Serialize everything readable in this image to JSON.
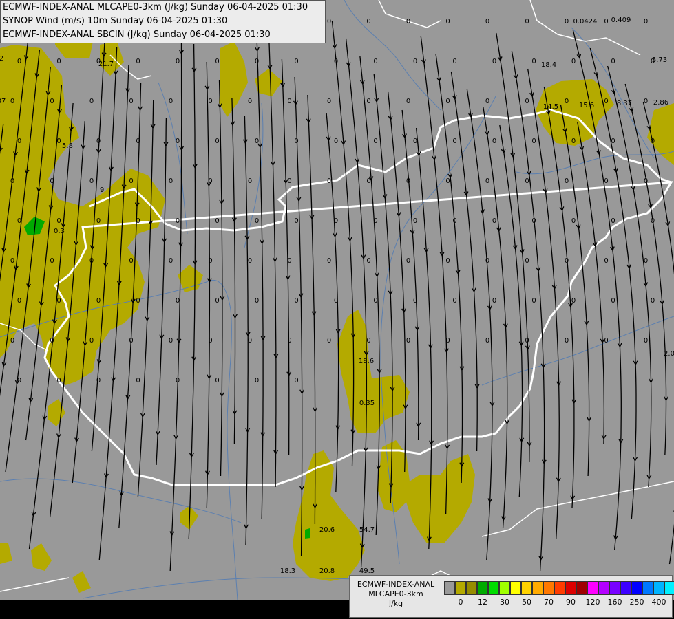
{
  "titles": [
    "ECMWF-INDEX-ANAL MLCAPE0-3km (J/kg) Sunday 06-04-2025 01:30",
    "SYNOP Wind (m/s) 10m Sunday 06-04-2025 01:30",
    "ECMWF-INDEX-ANAL SBCIN (J/kg) Sunday 06-04-2025 01:30"
  ],
  "legend": {
    "line1": "ECMWF-INDEX-ANAL",
    "line2": "MLCAPE0-3km",
    "unit": "J/kg",
    "colors": [
      "#999999",
      "#b4aa00",
      "#968c00",
      "#00aa00",
      "#00dc00",
      "#a0ff00",
      "#ffff00",
      "#ffd200",
      "#ffaa00",
      "#ff7800",
      "#ff3c00",
      "#dc0000",
      "#a00000",
      "#ff00ff",
      "#b400ff",
      "#7800ff",
      "#3c00ff",
      "#0000ff",
      "#0078ff",
      "#00b4ff",
      "#00f0ff",
      "#a0ffff",
      "#ffffff"
    ],
    "ticks": [
      "0",
      "12",
      "30",
      "50",
      "70",
      "90",
      "120",
      "160",
      "250",
      "400"
    ]
  },
  "colors": {
    "background": "#999999",
    "cape": "#b4aa00",
    "cape_high": "#00aa00",
    "border": "#ffffff",
    "river": "#5b7fb0",
    "streamline": "#000000"
  },
  "cin_labels": [
    "0",
    "0",
    "0",
    "0",
    "0",
    "0",
    "0",
    "0",
    "0",
    "0",
    "0",
    "0",
    "0",
    "0",
    "0",
    "0",
    "0",
    "0",
    "0",
    "0",
    "0",
    "0",
    "0",
    "0",
    "0",
    "0",
    "0",
    "0",
    "0",
    "0",
    "0",
    "0",
    "0",
    "0",
    "0",
    "0",
    "0",
    "0",
    "0",
    "0",
    "0",
    "0",
    "0",
    "0",
    "0",
    "0",
    "0",
    "0",
    "0",
    "0",
    "0",
    "0",
    "0",
    "0",
    "0",
    "0",
    "0",
    "0",
    "0",
    "0",
    "0",
    "0",
    "0",
    "0",
    "0",
    "0",
    "0",
    "0",
    "0",
    "0",
    "0",
    "0",
    "0",
    "0",
    "0",
    "0",
    "0",
    "0",
    "0",
    "0",
    "0",
    "0",
    "0",
    "0",
    "0",
    "0",
    "0",
    "0",
    "0",
    "0",
    "0",
    "0",
    "0",
    "0",
    "0",
    "0",
    "0",
    "0",
    "0",
    "0",
    "0",
    "0",
    "0",
    "0",
    "0",
    "0",
    "0",
    "0",
    "0",
    "0",
    "0",
    "0",
    "0",
    "0",
    "0",
    "0",
    "0",
    "0",
    "0",
    "0",
    "0",
    "0",
    "0",
    "0",
    "0",
    "0",
    "0",
    "0",
    "0",
    "0",
    "0",
    "0",
    "0",
    "0",
    "0",
    "0",
    "0",
    "0",
    "0",
    "0",
    "0",
    "0",
    "0",
    "0",
    "0",
    "0",
    "0",
    "0",
    "0",
    "0",
    "0",
    "0",
    "0",
    "0",
    "0",
    "0",
    "0",
    "0",
    "0",
    "0",
    "0.0424",
    "0.409",
    "5.73",
    "8.37",
    "2.86",
    "14.5",
    "15.6",
    "18.4",
    "21.7",
    "5.8",
    "0.3",
    "18.6",
    "0.35",
    "20.6",
    "54.7",
    "18.3",
    "20.8",
    "49.5",
    "2.0",
    "9",
    "2",
    "87",
    "0"
  ]
}
